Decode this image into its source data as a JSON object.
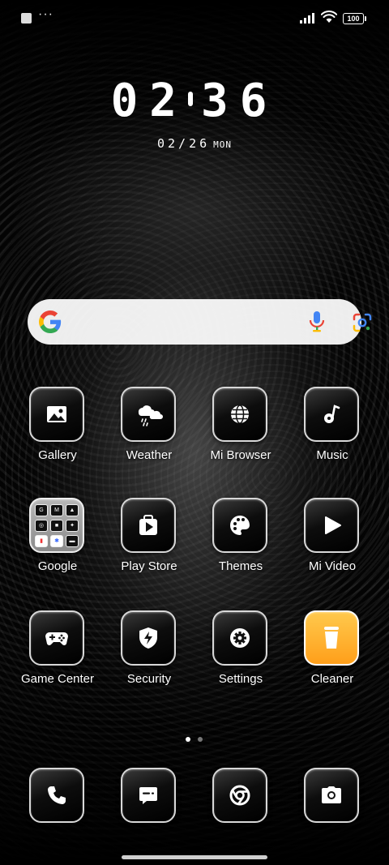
{
  "status_bar": {
    "dots": "···",
    "battery": "100",
    "icons": [
      "notification-square-icon",
      "more-dots-icon",
      "signal-icon",
      "wifi-icon",
      "battery-icon"
    ]
  },
  "clock": {
    "hour": "02",
    "minute": "36",
    "date": "02/26",
    "weekday": "MON"
  },
  "search": {
    "icons": [
      "google-logo-icon",
      "microphone-icon",
      "google-lens-icon"
    ],
    "colors": {
      "blue": "#4285F4",
      "red": "#EA4335",
      "yellow": "#FBBC05",
      "green": "#34A853"
    }
  },
  "apps": [
    {
      "label": "Gallery",
      "icon": "image-icon"
    },
    {
      "label": "Weather",
      "icon": "cloud-rain-icon"
    },
    {
      "label": "Mi Browser",
      "icon": "globe-icon"
    },
    {
      "label": "Music",
      "icon": "music-note-icon"
    },
    {
      "label": "Google",
      "icon": "app-folder-icon"
    },
    {
      "label": "Play Store",
      "icon": "shopping-bag-play-icon"
    },
    {
      "label": "Themes",
      "icon": "palette-icon"
    },
    {
      "label": "Mi Video",
      "icon": "play-icon"
    },
    {
      "label": "Game Center",
      "icon": "gamepad-icon"
    },
    {
      "label": "Security",
      "icon": "shield-bolt-icon"
    },
    {
      "label": "Settings",
      "icon": "gear-icon"
    },
    {
      "label": "Cleaner",
      "icon": "trash-icon",
      "color": "#FFB02E"
    }
  ],
  "dock": [
    {
      "icon": "phone-icon"
    },
    {
      "icon": "message-icon"
    },
    {
      "icon": "chrome-icon"
    },
    {
      "icon": "camera-icon"
    }
  ],
  "page_indicator": {
    "pages": 2,
    "active": 1
  }
}
